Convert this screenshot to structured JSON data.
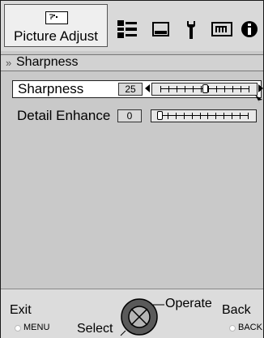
{
  "menubar": {
    "active_tab_label": "Picture Adjust",
    "icons": [
      "picture-icon",
      "audio-settings-icon",
      "display-icon",
      "setup-wrench-icon",
      "network-icon",
      "info-icon"
    ]
  },
  "breadcrumb": {
    "chevron": "»",
    "title": "Sharpness"
  },
  "settings": [
    {
      "name": "Sharpness",
      "value": "25",
      "level": 0.5,
      "selected": true
    },
    {
      "name": "Detail Enhance",
      "value": "0",
      "level": 0.0,
      "selected": false
    }
  ],
  "footer": {
    "exit_label": "Exit",
    "exit_key": "MENU",
    "select_label": "Select",
    "operate_label": "Operate",
    "back_label": "Back",
    "back_key": "BACK"
  }
}
